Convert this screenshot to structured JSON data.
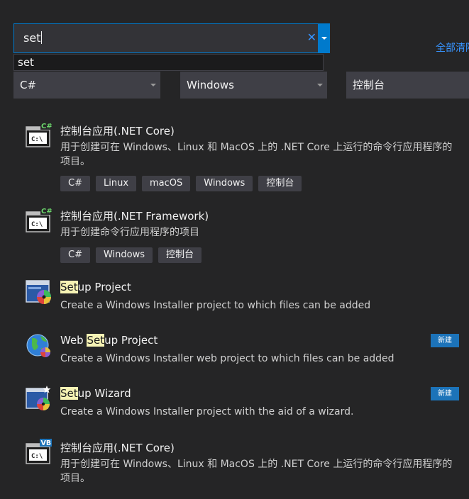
{
  "search": {
    "value": "set",
    "clear_glyph": "✕",
    "suggestion": "set"
  },
  "clear_all": "全部清除",
  "filters": {
    "language": "C#",
    "platform": "Windows",
    "project_type": "控制台"
  },
  "templates": [
    {
      "icon": "console-csharp-icon",
      "title": "控制台应用(.NET Core)",
      "description": "用于创建可在 Windows、Linux 和 MacOS 上的 .NET Core 上运行的命令行应用程序的项目。",
      "tags": [
        "C#",
        "Linux",
        "macOS",
        "Windows",
        "控制台"
      ]
    },
    {
      "icon": "console-csharp-icon",
      "title": "控制台应用(.NET Framework)",
      "description": "用于创建命令行应用程序的项目",
      "tags": [
        "C#",
        "Windows",
        "控制台"
      ]
    },
    {
      "icon": "setup-project-icon",
      "title_highlight": "Set",
      "title_rest": "up Project",
      "description": "Create a Windows Installer project to which files can be added"
    },
    {
      "icon": "web-setup-globe-icon",
      "title_prefix": "Web ",
      "title_highlight": "Set",
      "title_rest": "up Project",
      "description": "Create a Windows Installer web project to which files can be added",
      "badge": "新建"
    },
    {
      "icon": "setup-wizard-icon",
      "title_highlight": "Set",
      "title_rest": "up Wizard",
      "description": "Create a Windows Installer project with the aid of a wizard.",
      "badge": "新建"
    },
    {
      "icon": "console-vb-icon",
      "title": "控制台应用(.NET Core)",
      "description": "用于创建可在 Windows、Linux 和 MacOS 上的 .NET Core 上运行的命令行应用程序的项目。"
    }
  ],
  "colors": {
    "background": "#252526",
    "accent": "#007acc",
    "link": "#3794ff",
    "highlight": "#f6f3b4",
    "csharp_badge": "#388a34",
    "vb_badge": "#1c73b9"
  }
}
